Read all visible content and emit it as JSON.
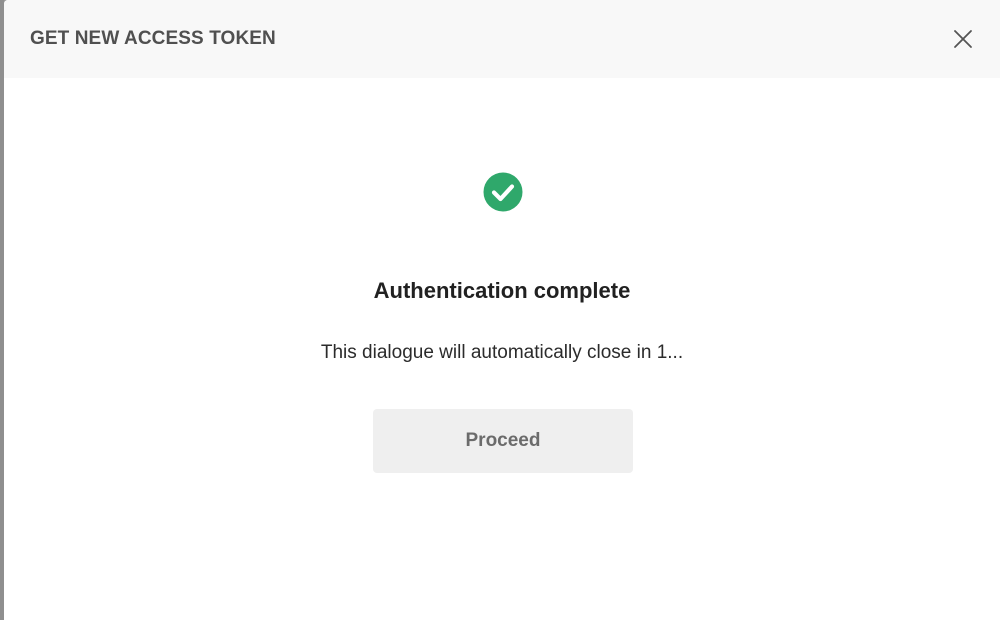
{
  "dialog": {
    "title": "GET NEW ACCESS TOKEN",
    "close_icon": "close-icon"
  },
  "status": {
    "icon": "check-circle-icon",
    "icon_color": "#2fa86b",
    "heading": "Authentication complete",
    "message": "This dialogue will automatically close in 1..."
  },
  "actions": {
    "proceed_label": "Proceed"
  }
}
